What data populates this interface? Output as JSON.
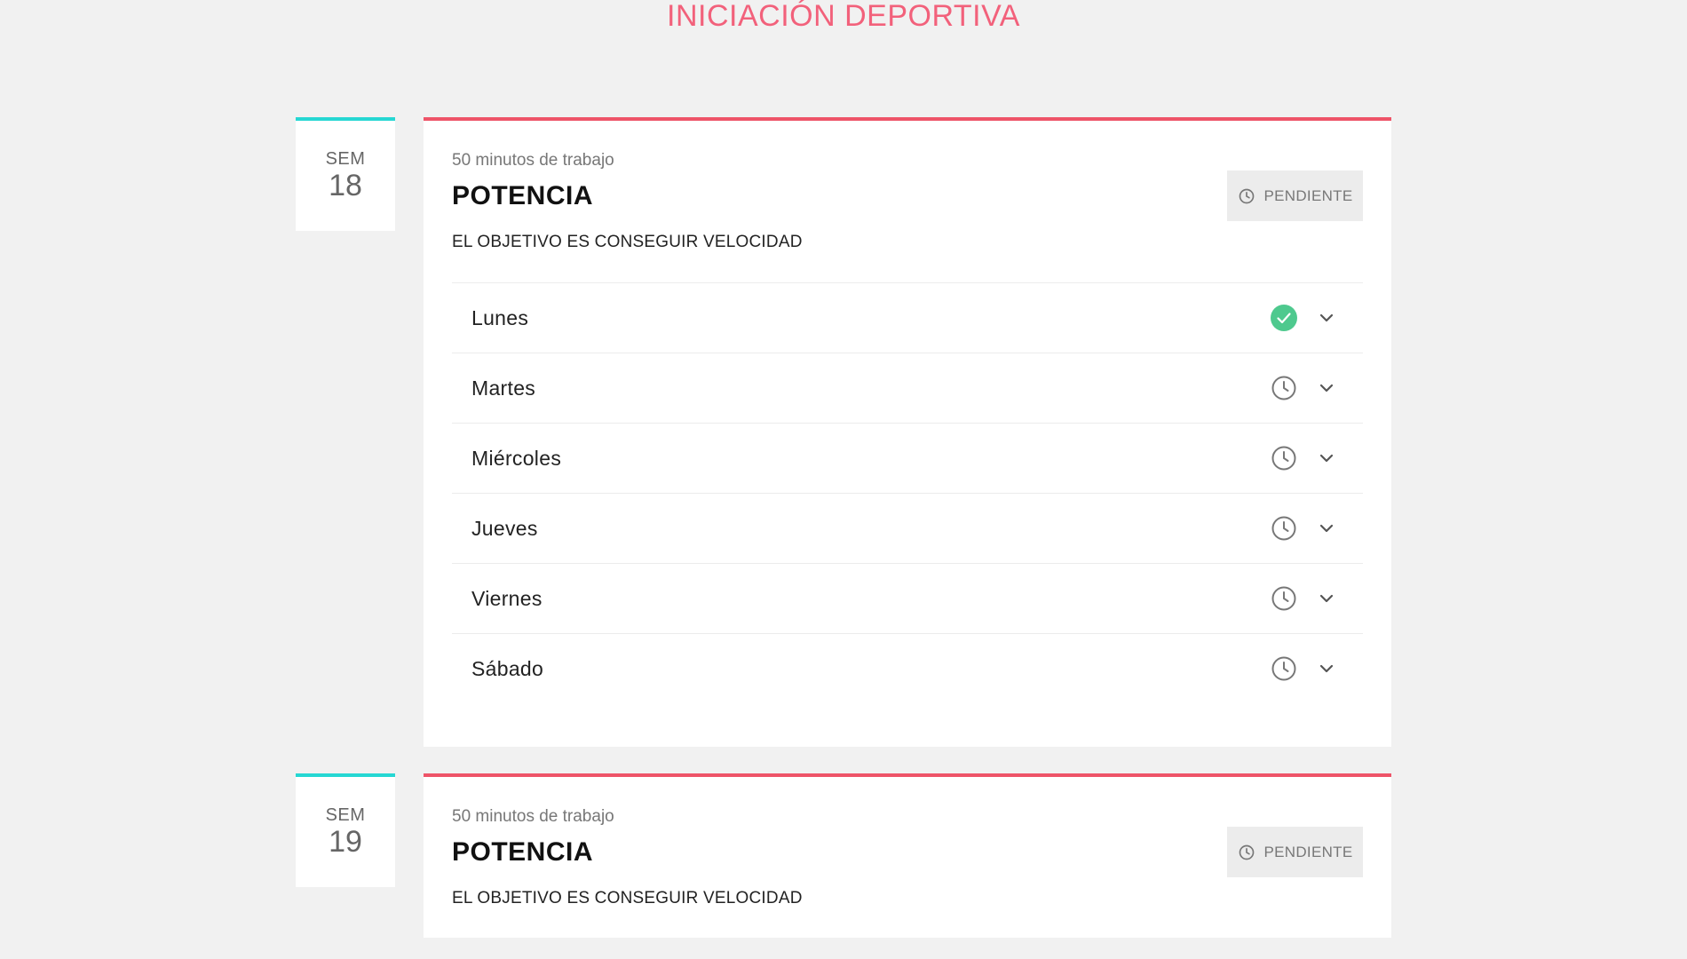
{
  "page": {
    "title": "INICIACIÓN DEPORTIVA"
  },
  "colors": {
    "accent_pink": "#f2617b",
    "card_border": "#ee5468",
    "badge_border": "#26d7d3",
    "done_green": "#4ec98e",
    "pending_gray": "#777777"
  },
  "weeks": [
    {
      "badge_prefix": "SEM",
      "number": "18",
      "minutes_label": "50 minutos de trabajo",
      "title": "POTENCIA",
      "objective": "EL OBJETIVO ES CONSEGUIR VELOCIDAD",
      "status_label": "PENDIENTE",
      "status_icon": "clock-icon",
      "days": [
        {
          "label": "Lunes",
          "status": "done",
          "status_icon": "check-circle-icon"
        },
        {
          "label": "Martes",
          "status": "pending",
          "status_icon": "clock-icon"
        },
        {
          "label": "Miércoles",
          "status": "pending",
          "status_icon": "clock-icon"
        },
        {
          "label": "Jueves",
          "status": "pending",
          "status_icon": "clock-icon"
        },
        {
          "label": "Viernes",
          "status": "pending",
          "status_icon": "clock-icon"
        },
        {
          "label": "Sábado",
          "status": "pending",
          "status_icon": "clock-icon"
        }
      ]
    },
    {
      "badge_prefix": "SEM",
      "number": "19",
      "minutes_label": "50 minutos de trabajo",
      "title": "POTENCIA",
      "objective": "EL OBJETIVO ES CONSEGUIR VELOCIDAD",
      "status_label": "PENDIENTE",
      "status_icon": "clock-icon"
    }
  ]
}
